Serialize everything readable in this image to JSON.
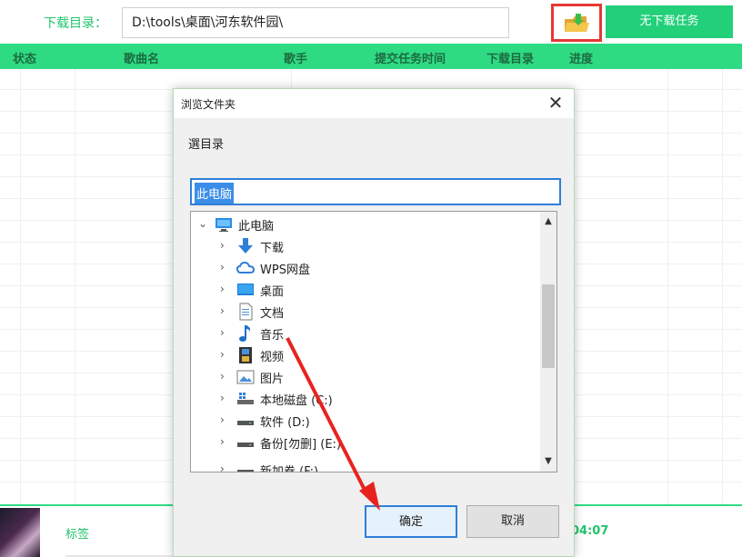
{
  "topbar": {
    "download_dir_label": "下载目录：",
    "download_dir_value": "D:\\tools\\桌面\\河东软件园\\",
    "no_task_label": "无下载任务"
  },
  "table": {
    "headers": [
      "状态",
      "歌曲名",
      "歌手",
      "提交任务时间",
      "下载目录",
      "进度"
    ]
  },
  "bottom": {
    "tag_label": "标签",
    "time": "04:07"
  },
  "dialog": {
    "title": "浏览文件夹",
    "description": "選目录",
    "path_value": "此电脑",
    "ok_label": "确定",
    "cancel_label": "取消",
    "tree": [
      {
        "label": "此电脑",
        "icon": "computer-icon",
        "expanded": true
      },
      {
        "label": "下载",
        "icon": "download-arrow-icon"
      },
      {
        "label": "WPS网盘",
        "icon": "cloud-icon"
      },
      {
        "label": "桌面",
        "icon": "desktop-icon"
      },
      {
        "label": "文档",
        "icon": "document-icon"
      },
      {
        "label": "音乐",
        "icon": "music-note-icon"
      },
      {
        "label": "视频",
        "icon": "video-icon"
      },
      {
        "label": "图片",
        "icon": "picture-icon"
      },
      {
        "label": "本地磁盘 (C:)",
        "icon": "system-drive-icon"
      },
      {
        "label": "软件 (D:)",
        "icon": "drive-icon"
      },
      {
        "label": "备份[勿删] (E:)",
        "icon": "drive-icon"
      },
      {
        "label": "新加卷 (F:)",
        "icon": "drive-icon"
      }
    ]
  },
  "colors": {
    "accent_green": "#2edb83",
    "highlight_red": "#e53935",
    "selection_blue": "#3b8ee8"
  }
}
